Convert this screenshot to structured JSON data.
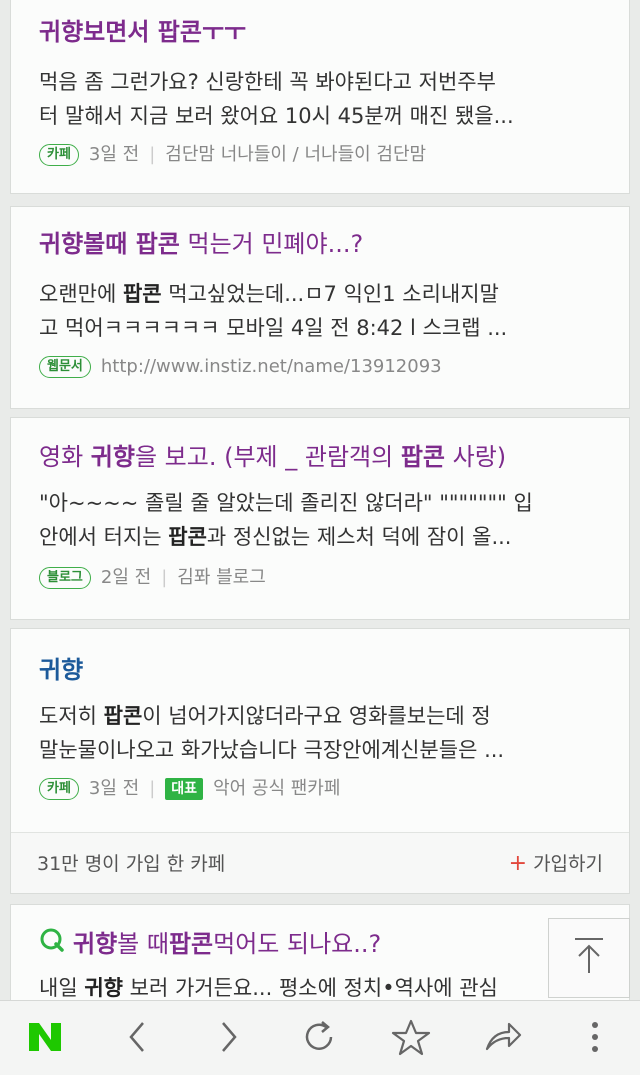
{
  "results": [
    {
      "title_pre": "귀향보면서 ",
      "title_bold": "팝콘",
      "title_post": "ㅜㅜ",
      "line1": "먹음 좀 그런가요? 신랑한테 꼭 봐야된다고 저번주부",
      "line2": "터 말해서 지금 보러 왔어요 10시 45분꺼 매진 됐을...",
      "badge": "카페",
      "age": "3일 전",
      "source": "검단맘 너나들이 / 너나들이 검단맘"
    },
    {
      "title_pre": "귀향볼때 ",
      "title_bold": "팝콘",
      "title_post": " 먹는거 민폐야...?",
      "line1_pre": "오랜만에 ",
      "line1_bold": "팝콘",
      "line1_post": " 먹고싶었는데...ㅁ7 익인1 소리내지말",
      "line2": "고 먹어ㅋㅋㅋㅋㅋㅋ 모바일 4일 전 8:42 l 스크랩 ...",
      "badge": "웹문서",
      "url": "http://www.instiz.net/name/13912093"
    },
    {
      "title_pre": "영화 ",
      "title_bold": "귀향",
      "title_mid": "을 보고. (부제 _ 관람객의 ",
      "title_bold2": "팝콘",
      "title_post": " 사랑)",
      "line1": "\"아~~~~ 졸릴 줄 알았는데 졸리진 않더라\" \"\"\"\"\"\"\" 입",
      "line2_pre": "안에서 터지는 ",
      "line2_bold": "팝콘",
      "line2_post": "과 정신없는 제스처 덕에 잠이 올...",
      "badge": "블로그",
      "age": "2일 전",
      "source": "김퐈 블로그"
    },
    {
      "title": "귀향",
      "line1_pre": "도저히 ",
      "line1_bold": "팝콘",
      "line1_post": "이 넘어가지않더라구요 영화를보는데 정",
      "line2": "말눈물이나오고 화가났습니다 극장안에계신분들은 ...",
      "badge": "카페",
      "age": "3일 전",
      "rep_badge": "대표",
      "source": "악어 공식 팬카페",
      "members": "31만 명이 가입 한 카페",
      "join": "가입하기"
    },
    {
      "title_bold": "귀향",
      "title_mid": " 볼 때 ",
      "title_bold2": "팝콘",
      "title_post": " 먹어도 되나요..?",
      "line1_pre": "내일 ",
      "line1_bold": "귀향",
      "line1_post": " 보러 가거든요... 평소에 정치•역사에 관심"
    }
  ],
  "colors": {
    "title": "#7d2b8c",
    "title_blue": "#1c5a9a",
    "green": "#2fb344",
    "naver_green": "#1ec800"
  },
  "icons": [
    "naver-logo-icon",
    "back-icon",
    "forward-icon",
    "refresh-icon",
    "bookmark-star-icon",
    "share-icon",
    "more-icon",
    "scroll-top-icon",
    "question-icon"
  ]
}
